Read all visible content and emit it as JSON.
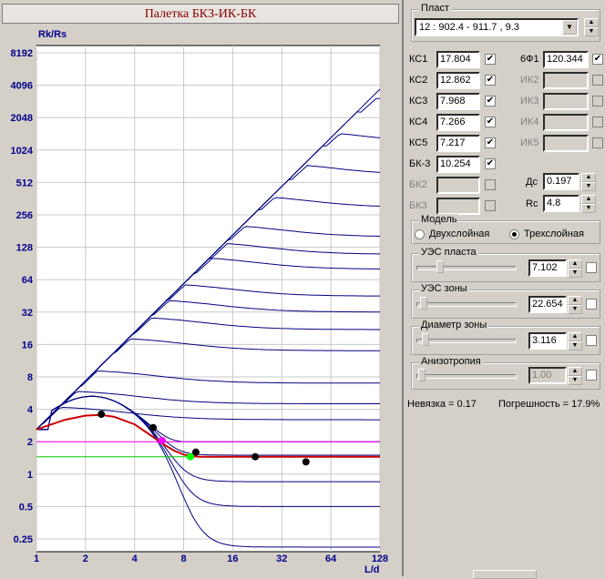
{
  "chart_title": "Палетка БКЗ-ИК-БК",
  "chart_data": {
    "type": "line",
    "title": "Палетка БКЗ-ИК-БК",
    "ylabel": "Rk/Rs",
    "xlabel": "L/d",
    "x_scale": "log2",
    "y_scale": "log2",
    "xlim": [
      1,
      128
    ],
    "ylim": [
      0.21,
      10000
    ],
    "x_ticks": [
      "1",
      "2",
      "4",
      "8",
      "16",
      "32",
      "64",
      "128"
    ],
    "y_ticks": [
      "8192",
      "4096",
      "2048",
      "1024",
      "512",
      "256",
      "128",
      "64",
      "32",
      "16",
      "8",
      "4",
      "2",
      "1",
      "0.5",
      "0.25"
    ],
    "x_tick_values": [
      1,
      2,
      4,
      8,
      16,
      32,
      64,
      128
    ],
    "y_tick_values": [
      8192,
      4096,
      2048,
      1024,
      512,
      256,
      128,
      64,
      32,
      16,
      8,
      4,
      2,
      1,
      0.5,
      0.25
    ],
    "grid": true,
    "curve_color": "#000080",
    "family_asymptotes": [
      0.21,
      0.5,
      0.85,
      1.5,
      2.0,
      3.2,
      4.5,
      7,
      14,
      22,
      32,
      45,
      80,
      110,
      160,
      300,
      600,
      1200,
      2600,
      4200
    ],
    "horizontal_lines": [
      {
        "name": "magenta-line",
        "y": 2.0,
        "color": "#ff00ff"
      },
      {
        "name": "green-line",
        "y": 1.45,
        "color": "#00cc00"
      }
    ],
    "measured_points": [
      {
        "x": 2.5,
        "y": 3.6
      },
      {
        "x": 5.2,
        "y": 2.7
      },
      {
        "x": 9.5,
        "y": 1.6
      },
      {
        "x": 22,
        "y": 1.45
      },
      {
        "x": 45,
        "y": 1.3
      }
    ],
    "highlight_points": [
      {
        "x": 5.9,
        "y": 2.05,
        "color": "#ff00ff"
      },
      {
        "x": 8.8,
        "y": 1.45,
        "color": "#00ff00"
      }
    ],
    "fit_curve": [
      [
        1,
        2.6
      ],
      [
        1.5,
        3.2
      ],
      [
        2,
        3.5
      ],
      [
        2.5,
        3.55
      ],
      [
        3,
        3.4
      ],
      [
        4,
        2.9
      ],
      [
        5,
        2.3
      ],
      [
        6,
        1.9
      ],
      [
        7,
        1.65
      ],
      [
        8,
        1.52
      ],
      [
        9,
        1.47
      ],
      [
        10,
        1.45
      ],
      [
        16,
        1.45
      ],
      [
        128,
        1.45
      ]
    ],
    "fit_color": "#cc0000"
  },
  "panel": {
    "plast_label": "Пласт",
    "plast_value": "12 : 902.4 - 911.7 , 9.3",
    "params_left": [
      {
        "label": "КС1",
        "value": "17.804",
        "checked": true
      },
      {
        "label": "КС2",
        "value": "12.862",
        "checked": true
      },
      {
        "label": "КС3",
        "value": "7.968",
        "checked": true
      },
      {
        "label": "КС4",
        "value": "7.266",
        "checked": true
      },
      {
        "label": "КС5",
        "value": "7.217",
        "checked": true
      },
      {
        "label": "БК-3",
        "value": "10.254",
        "checked": true
      },
      {
        "label": "БК2",
        "value": "",
        "checked": false,
        "disabled": true
      },
      {
        "label": "БК3",
        "value": "",
        "checked": false,
        "disabled": true
      }
    ],
    "params_right": [
      {
        "label": "6Ф1",
        "value": "120.344",
        "checked": true
      },
      {
        "label": "ИК2",
        "value": "",
        "checked": false,
        "disabled": true
      },
      {
        "label": "ИК3",
        "value": "",
        "checked": false,
        "disabled": true
      },
      {
        "label": "ИК4",
        "value": "",
        "checked": false,
        "disabled": true
      },
      {
        "label": "ИК5",
        "value": "",
        "checked": false,
        "disabled": true
      }
    ],
    "dc_label": "Дс",
    "dc_value": "0.197",
    "rc_label": "Rc",
    "rc_value": "4.8",
    "model_label": "Модель",
    "model_two": "Двухслойная",
    "model_three": "Трехслойная",
    "model_selected": "three",
    "uzs_plast_label": "УЭС пласта",
    "uzs_plast_value": "7.102",
    "uzs_plast_level": 0.22,
    "uzs_zone_label": "УЭС зоны",
    "uzs_zone_value": "22.654",
    "uzs_zone_level": 0.04,
    "diam_label": "Диаметр зоны",
    "diam_value": "3.116",
    "diam_level": 0.06,
    "aniso_label": "Анизотропия",
    "aniso_value": "1.00",
    "aniso_level": 0.02,
    "nevyazka_label": "Невязка = 0.17",
    "pogreshnost_label": "Погрешность = 17.9%"
  }
}
